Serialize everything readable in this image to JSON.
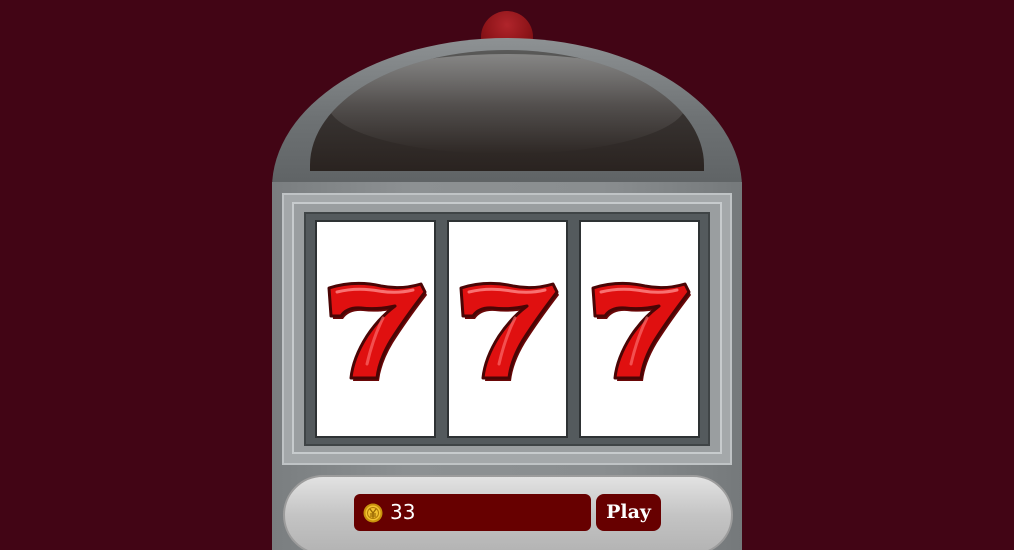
{
  "machine": {
    "knob_icon": "red-knob",
    "reels": [
      {
        "symbol": "7",
        "icon": "seven-icon"
      },
      {
        "symbol": "7",
        "icon": "seven-icon"
      },
      {
        "symbol": "7",
        "icon": "seven-icon"
      }
    ]
  },
  "controls": {
    "balance": "33",
    "coin_icon": "coin-icon",
    "play_label": "Play"
  },
  "colors": {
    "background": "#420515",
    "panel_button": "#670000",
    "seven_red": "#e01010"
  }
}
